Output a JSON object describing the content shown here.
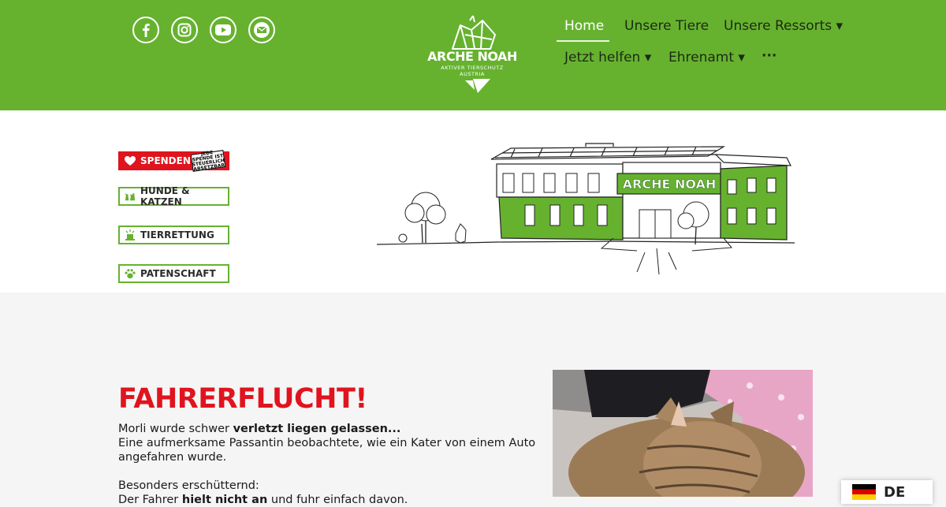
{
  "header": {
    "social": [
      {
        "name": "facebook-icon"
      },
      {
        "name": "instagram-icon"
      },
      {
        "name": "youtube-icon"
      },
      {
        "name": "email-icon"
      }
    ],
    "logo": {
      "title": "ARCHE NOAH",
      "subtitle": "AKTIVER TIERSCHUTZ",
      "subtitle2": "AUSTRIA"
    },
    "nav": {
      "home": "Home",
      "tiere": "Unsere Tiere",
      "ressorts": "Unsere Ressorts ▾",
      "helfen": "Jetzt helfen ▾",
      "ehrenamt": "Ehrenamt ▾",
      "more": "···"
    }
  },
  "sidebar": {
    "spenden": "SPENDEN",
    "badge": "JEDE SPENDE IST STEUERLICH ABSETZBAR",
    "hunde": "HUNDE & KATZEN",
    "tierrettung": "TIERRETTUNG",
    "patenschaft": "PATENSCHAFT"
  },
  "building": {
    "sign": "ARCHE NOAH"
  },
  "article": {
    "title": "FAHRERFLUCHT!",
    "line1_a": "Morli wurde schwer ",
    "line1_b": "verletzt liegen gelassen...",
    "line2": "Eine aufmerksame Passantin beobachtete, wie ein Kater von einem Auto",
    "line3": "angefahren wurde.",
    "line4": "Besonders erschütternd:",
    "line5_a": "Der Fahrer ",
    "line5_b": "hielt nicht an",
    "line5_c": " und fuhr einfach davon."
  },
  "language": {
    "code": "DE"
  },
  "colors": {
    "brand_green": "#66b22f",
    "accent_red": "#e0141e"
  }
}
